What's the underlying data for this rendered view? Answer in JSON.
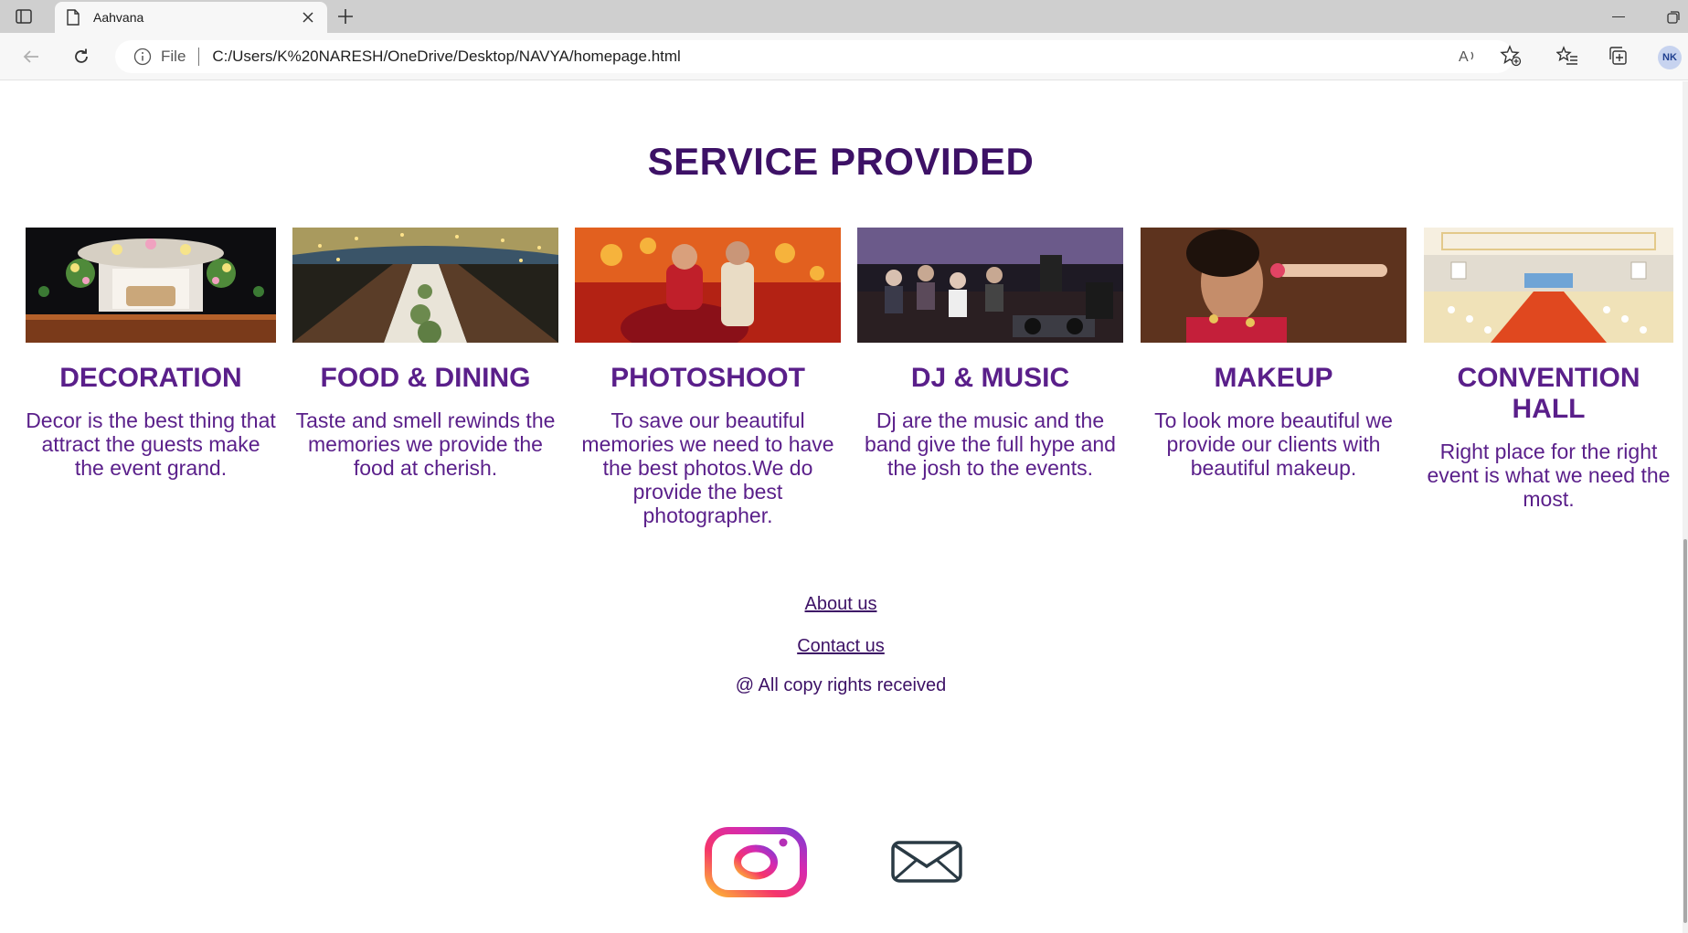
{
  "browser": {
    "tab_title": "Aahvana",
    "address_prefix": "File",
    "url": "C:/Users/K%20NARESH/OneDrive/Desktop/NAVYA/homepage.html",
    "profile_initials": "NK"
  },
  "page": {
    "section_title": "SERVICE PROVIDED",
    "services": [
      {
        "title": "DECORATION",
        "description": "Decor is the best thing that attract the guests make the event grand.",
        "image": "decoration-photo"
      },
      {
        "title": "FOOD & DINING",
        "description": "Taste and smell rewinds the memories we provide the food at cherish.",
        "image": "dining-photo"
      },
      {
        "title": "PHOTOSHOOT",
        "description": "To save our beautiful memories we need to have the best photos.We do provide the best photographer.",
        "image": "photoshoot-photo"
      },
      {
        "title": "DJ & MUSIC",
        "description": "Dj are the music and the band give the full hype and the josh to the events.",
        "image": "dj-photo"
      },
      {
        "title": "MAKEUP",
        "description": "To look more beautiful we provide our clients with beautiful makeup.",
        "image": "makeup-photo"
      },
      {
        "title": "CONVENTION HALL",
        "description": "Right place for the right event is what we need the most.",
        "image": "convention-hall-photo"
      }
    ],
    "footer": {
      "about_link": "About us",
      "contact_link": "Contact us",
      "copyright": "@ All copy rights received"
    }
  },
  "icons": [
    "instagram-icon",
    "mail-icon"
  ],
  "colors": {
    "heading": "#3d1166",
    "text": "#5a1f8a"
  }
}
